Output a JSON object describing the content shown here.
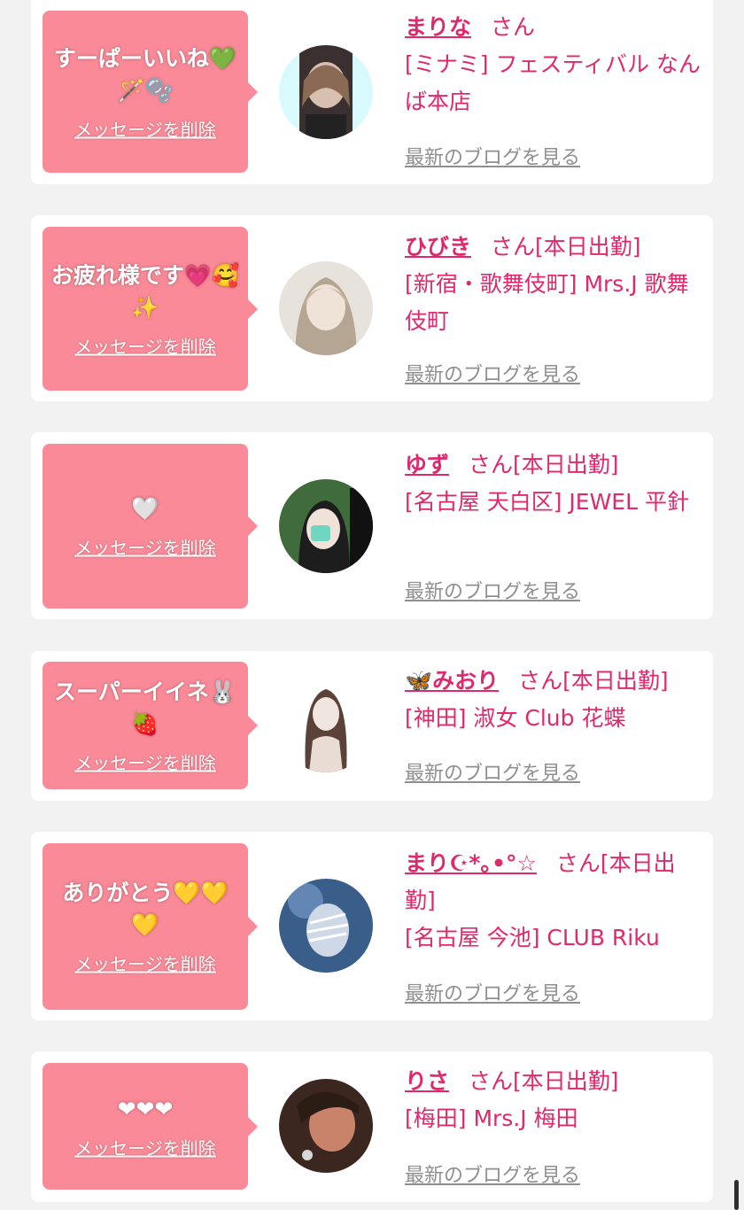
{
  "cards": [
    {
      "message": "すーぱーいいね💚🪄🫧",
      "delete_label": "メッセージを削除",
      "name": "まりな",
      "suffix": "さん",
      "shop": "[ミナミ] フェスティバル なんば本店",
      "blog_label": "最新のブログを見る",
      "avatar_colors": [
        "#3a3030",
        "#d8c0b0"
      ],
      "avatar_bg": "#d9fafc"
    },
    {
      "message": "お疲れ様です💗🥰✨",
      "delete_label": "メッセージを削除",
      "name": "ひびき",
      "suffix": "さん[本日出勤]",
      "shop": "[新宿・歌舞伎町] Mrs.J 歌舞伎町",
      "blog_label": "最新のブログを見る",
      "avatar_colors": [
        "#d9cfc4",
        "#8a7c73"
      ],
      "avatar_bg": "#e8e2dc"
    },
    {
      "message": "🤍",
      "delete_label": "メッセージを削除",
      "name": "ゆず",
      "suffix": "さん[本日出勤]",
      "shop": "[名古屋 天白区] JEWEL 平針",
      "blog_label": "最新のブログを見る",
      "avatar_colors": [
        "#2f5e33",
        "#eaeaea"
      ],
      "avatar_bg": "#3f6b3d"
    },
    {
      "message": "スーパーイイネ🐰🍓",
      "delete_label": "メッセージを削除",
      "name": "🦋みおり",
      "suffix": "さん[本日出勤]",
      "shop": "[神田] 淑女 Club 花蝶",
      "blog_label": "最新のブログを見る",
      "avatar_colors": [
        "#5a4238",
        "#f1e6df"
      ],
      "avatar_bg": "#ffffff"
    },
    {
      "message": "ありがとう💛💛💛",
      "delete_label": "メッセージを削除",
      "name": "まり☪︎*｡•°☆",
      "suffix": "さん[本日出勤]",
      "shop": "[名古屋 今池] CLUB Riku",
      "blog_label": "最新のブログを見る",
      "avatar_colors": [
        "#2a4d7a",
        "#cfd8e6"
      ],
      "avatar_bg": "#3a5e8a"
    },
    {
      "message": "❤︎❤︎❤︎",
      "delete_label": "メッセージを削除",
      "name": "りさ",
      "suffix": "さん[本日出勤]",
      "shop": "[梅田] Mrs.J 梅田",
      "blog_label": "最新のブログを見る",
      "avatar_colors": [
        "#2b1c16",
        "#c9836a"
      ],
      "avatar_bg": "#3b271f"
    }
  ]
}
